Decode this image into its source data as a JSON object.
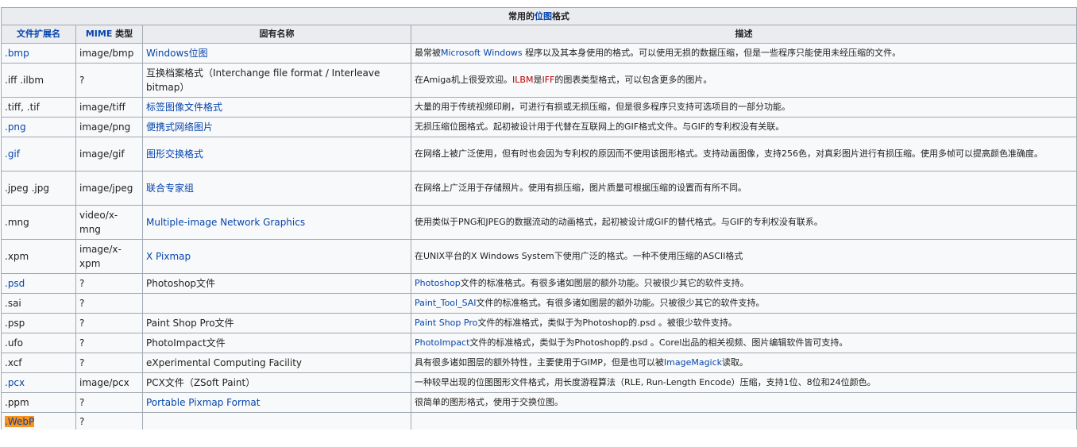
{
  "caption": {
    "pre": "常用的",
    "link": "位图",
    "post": "格式"
  },
  "headers": {
    "ext": "文件扩展名",
    "mime": "MIME 类型",
    "name": "固有名称",
    "desc": "描述"
  },
  "rows": [
    {
      "ext": ".bmp",
      "ext_link": true,
      "mime": "image/bmp",
      "name": "Windows位图",
      "name_link": true,
      "desc": [
        {
          "t": "最常被"
        },
        {
          "t": "Microsoft Windows",
          "link": true
        },
        {
          "t": " 程序以及其本身使用的格式。可以使用无损的数据压缩，但是一些程序只能使用未经压缩的文件。"
        }
      ]
    },
    {
      "ext": ".iff .ilbm",
      "mime": "?",
      "name": "互换档案格式（Interchange file format / Interleave bitmap）",
      "desc": [
        {
          "t": "在Amiga机上很受欢迎。"
        },
        {
          "t": "ILBM",
          "red": true
        },
        {
          "t": "是"
        },
        {
          "t": "IFF",
          "red": true
        },
        {
          "t": "的图表类型格式，可以包含更多的图片。"
        }
      ]
    },
    {
      "ext": ".tiff, .tif",
      "mime": "image/tiff",
      "name": "标签图像文件格式",
      "name_link": true,
      "desc": [
        {
          "t": "大量的用于传统视频印刷，可进行有损或无损压缩，但是很多程序只支持可选项目的一部分功能。"
        }
      ]
    },
    {
      "ext": ".png",
      "ext_link": true,
      "mime": "image/png",
      "name": "便携式网络图片",
      "name_link": true,
      "desc": [
        {
          "t": "无损压缩位图格式。起初被设计用于代替在互联网上的GIF格式文件。与GIF的专利权没有关联。"
        }
      ]
    },
    {
      "ext": ".gif",
      "ext_link": true,
      "mime": "image/gif",
      "name": "图形交换格式",
      "name_link": true,
      "desc": [
        {
          "t": "在网络上被广泛使用，但有时也会因为专利权的原因而不使用该图形格式。支持动画图像，支持256色，对真彩图片进行有损压缩。使用多帧可以提高颜色准确度。"
        }
      ]
    },
    {
      "ext": ".jpeg .jpg",
      "mime": "image/jpeg",
      "name": "联合专家组",
      "name_link": true,
      "desc": [
        {
          "t": "在网络上广泛用于存储照片。使用有损压缩，图片质量可根据压缩的设置而有所不同。"
        }
      ]
    },
    {
      "ext": ".mng",
      "mime": "video/x-mng",
      "name": "Multiple-image Network Graphics",
      "name_link": true,
      "desc": [
        {
          "t": "使用类似于PNG和JPEG的数据流动的动画格式，起初被设计成GIF的替代格式。与GIF的专利权没有联系。"
        }
      ]
    },
    {
      "ext": ".xpm",
      "mime": "image/x-xpm",
      "name": "X Pixmap",
      "name_link": true,
      "desc": [
        {
          "t": "在UNIX平台的X Windows System下使用广泛的格式。一种不使用压缩的ASCII格式"
        }
      ]
    },
    {
      "ext": ".psd",
      "ext_link": true,
      "mime": "?",
      "name": "Photoshop文件",
      "desc": [
        {
          "t": "Photoshop",
          "link": true
        },
        {
          "t": "文件的标准格式。有很多诸如图层的额外功能。只被很少其它的软件支持。"
        }
      ]
    },
    {
      "ext": ".sai",
      "mime": "?",
      "name": "",
      "desc": [
        {
          "t": "Paint_Tool_SAI",
          "link": true
        },
        {
          "t": "文件的标准格式。有很多诸如图层的额外功能。只被很少其它的软件支持。"
        }
      ]
    },
    {
      "ext": ".psp",
      "mime": "?",
      "name": "Paint Shop Pro文件",
      "desc": [
        {
          "t": "Paint Shop Pro",
          "link": true
        },
        {
          "t": "文件的标准格式，类似于为Photoshop的.psd 。被很少软件支持。"
        }
      ]
    },
    {
      "ext": ".ufo",
      "mime": "?",
      "name": "PhotoImpact文件",
      "desc": [
        {
          "t": "PhotoImpact",
          "link": true
        },
        {
          "t": "文件的标准格式，类似于为Photoshop的.psd 。Corel出品的相关视频、图片编辑软件皆可支持。"
        }
      ]
    },
    {
      "ext": ".xcf",
      "mime": "?",
      "name": "eXperimental Computing Facility",
      "desc": [
        {
          "t": "具有很多诸如图层的额外特性，主要使用于GIMP，但是也可以被"
        },
        {
          "t": "ImageMagick",
          "link": true
        },
        {
          "t": "读取。"
        }
      ]
    },
    {
      "ext": ".pcx",
      "ext_link": true,
      "mime": "image/pcx",
      "name": "PCX文件（ZSoft Paint）",
      "desc": [
        {
          "t": "一种较早出现的位图图形文件格式，用长度游程算法（RLE, Run-Length Encode）压缩，支持1位、8位和24位颜色。"
        }
      ]
    },
    {
      "ext": ".ppm",
      "mime": "?",
      "name": "Portable Pixmap Format",
      "name_link": true,
      "desc": [
        {
          "t": "很简单的图形格式，使用于交换位图。"
        }
      ]
    },
    {
      "ext": ".WebP",
      "ext_highlight": true,
      "mime": "?",
      "name": "",
      "desc": []
    }
  ],
  "row_heights": [
    25,
    43,
    25,
    25,
    43,
    43,
    43,
    43,
    25,
    25,
    25,
    25,
    25,
    25,
    25,
    22
  ]
}
